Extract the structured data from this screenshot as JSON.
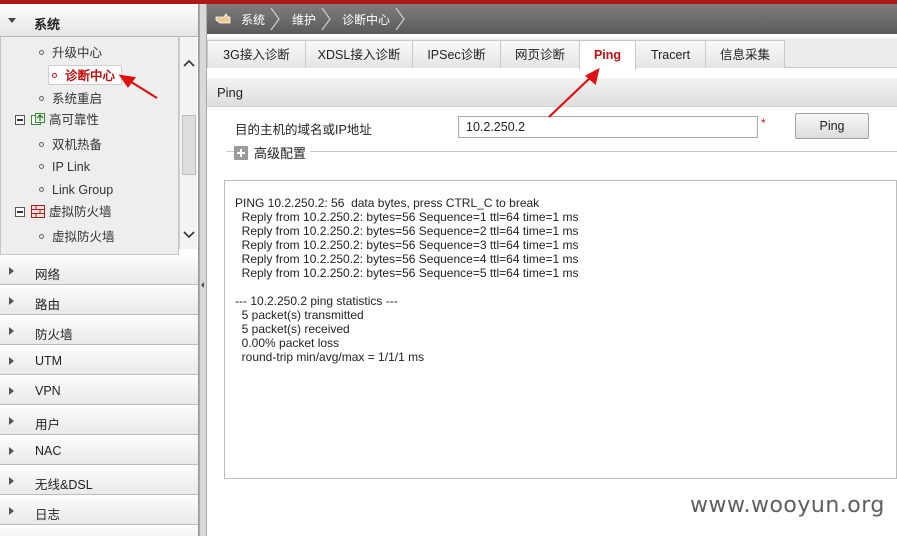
{
  "sidebar": {
    "section_title": "系统",
    "tree": {
      "items": [
        {
          "label": "升级中心"
        },
        {
          "label": "诊断中心"
        },
        {
          "label": "系统重启"
        }
      ],
      "groups": [
        {
          "label": "高可靠性",
          "children": [
            {
              "label": "双机热备"
            },
            {
              "label": "IP Link"
            },
            {
              "label": "Link Group"
            }
          ]
        },
        {
          "label": "虚拟防火墙",
          "children": [
            {
              "label": "虚拟防火墙"
            }
          ]
        }
      ]
    },
    "menu": [
      {
        "label": "网络"
      },
      {
        "label": "路由"
      },
      {
        "label": "防火墙"
      },
      {
        "label": "UTM"
      },
      {
        "label": "VPN"
      },
      {
        "label": "用户"
      },
      {
        "label": "NAC"
      },
      {
        "label": "无线&DSL"
      },
      {
        "label": "日志"
      }
    ]
  },
  "breadcrumb": [
    "系统",
    "维护",
    "诊断中心"
  ],
  "tabs": [
    {
      "label": "3G接入诊断"
    },
    {
      "label": "XDSL接入诊断"
    },
    {
      "label": "IPSec诊断"
    },
    {
      "label": "网页诊断"
    },
    {
      "label": "Ping"
    },
    {
      "label": "Tracert"
    },
    {
      "label": "信息采集"
    }
  ],
  "panel": {
    "title": "Ping",
    "target_label": "目的主机的域名或IP地址",
    "target_value": "10.2.250.2",
    "required_mark": "*",
    "ping_button": "Ping",
    "advanced_label": "高级配置"
  },
  "output_lines": [
    "PING 10.2.250.2: 56  data bytes, press CTRL_C to break",
    "  Reply from 10.2.250.2: bytes=56 Sequence=1 ttl=64 time=1 ms",
    "  Reply from 10.2.250.2: bytes=56 Sequence=2 ttl=64 time=1 ms",
    "  Reply from 10.2.250.2: bytes=56 Sequence=3 ttl=64 time=1 ms",
    "  Reply from 10.2.250.2: bytes=56 Sequence=4 ttl=64 time=1 ms",
    "  Reply from 10.2.250.2: bytes=56 Sequence=5 ttl=64 time=1 ms",
    "",
    "--- 10.2.250.2 ping statistics ---",
    "  5 packet(s) transmitted",
    "  5 packet(s) received",
    "  0.00% packet loss",
    "  round-trip min/avg/max = 1/1/1 ms"
  ],
  "watermark": "www.wooyun.org",
  "colors": {
    "accent": "#c20f0f",
    "topbar": "#b01818",
    "annotation_arrow": "#e01010"
  }
}
